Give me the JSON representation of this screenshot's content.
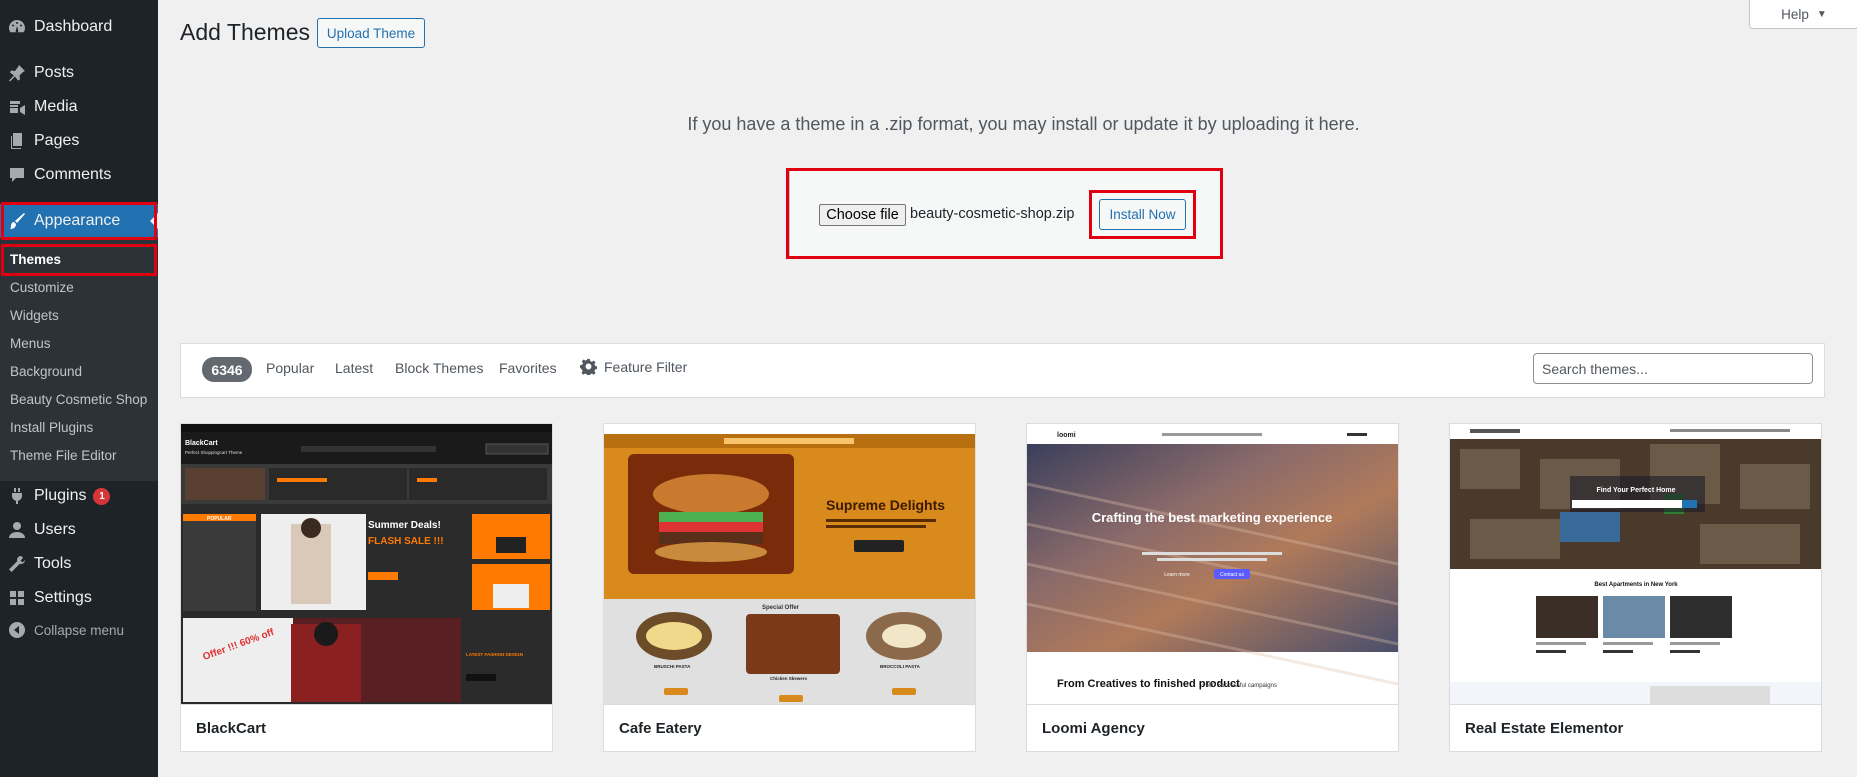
{
  "sidebar": {
    "items": {
      "dashboard": "Dashboard",
      "posts": "Posts",
      "media": "Media",
      "pages": "Pages",
      "comments": "Comments",
      "appearance": "Appearance",
      "plugins": "Plugins",
      "plugins_badge": "1",
      "users": "Users",
      "tools": "Tools",
      "settings": "Settings",
      "collapse": "Collapse menu"
    },
    "submenu": {
      "themes": "Themes",
      "customize": "Customize",
      "widgets": "Widgets",
      "menus": "Menus",
      "background": "Background",
      "beauty": "Beauty Cosmetic Shop",
      "install_plugins": "Install Plugins",
      "theme_file_editor": "Theme File Editor"
    }
  },
  "header": {
    "title": "Add Themes",
    "upload_button": "Upload Theme",
    "help": "Help"
  },
  "upload": {
    "description": "If you have a theme in a .zip format, you may install or update it by uploading it here.",
    "choose_file": "Choose file",
    "file_name": "beauty-cosmetic-shop.zip",
    "install_button": "Install Now"
  },
  "filters": {
    "count": "6346",
    "popular": "Popular",
    "latest": "Latest",
    "block_themes": "Block Themes",
    "favorites": "Favorites",
    "feature_filter": "Feature Filter",
    "search_placeholder": "Search themes..."
  },
  "themes": [
    {
      "name": "BlackCart"
    },
    {
      "name": "Cafe Eatery"
    },
    {
      "name": "Loomi Agency"
    },
    {
      "name": "Real Estate Elementor"
    }
  ],
  "previews": {
    "blackcart": {
      "brand": "BlackCart",
      "tagline": "Perfect Shoppingcart Theme",
      "popular": "POPULAR",
      "summer": "Summer Deals!",
      "flash": "FLASH SALE !!!",
      "offer": "Offer !!! 60% off",
      "latest": "LATEST FASHION DESIGN"
    },
    "cafe": {
      "headline": "Supreme Delights",
      "special": "Special Offer",
      "item1": "BRUSCHI PASTA",
      "item2": "Chicken Skewers",
      "item3": "BROCCOLI PASTA"
    },
    "loomi": {
      "brand": "loomi",
      "headline": "Crafting the best marketing experience",
      "cta1": "Learn more",
      "cta2": "Contact us",
      "sub": "From Creatives to finished product",
      "stat": "+500 Successful campaigns"
    },
    "realestate": {
      "hero": "Find Your Perfect Home",
      "section": "Best Apartments in New York"
    }
  },
  "colors": {
    "sidebar_bg": "#1d2327",
    "submenu_bg": "#2c3338",
    "accent": "#2271b1",
    "highlight": "#e0000f"
  }
}
